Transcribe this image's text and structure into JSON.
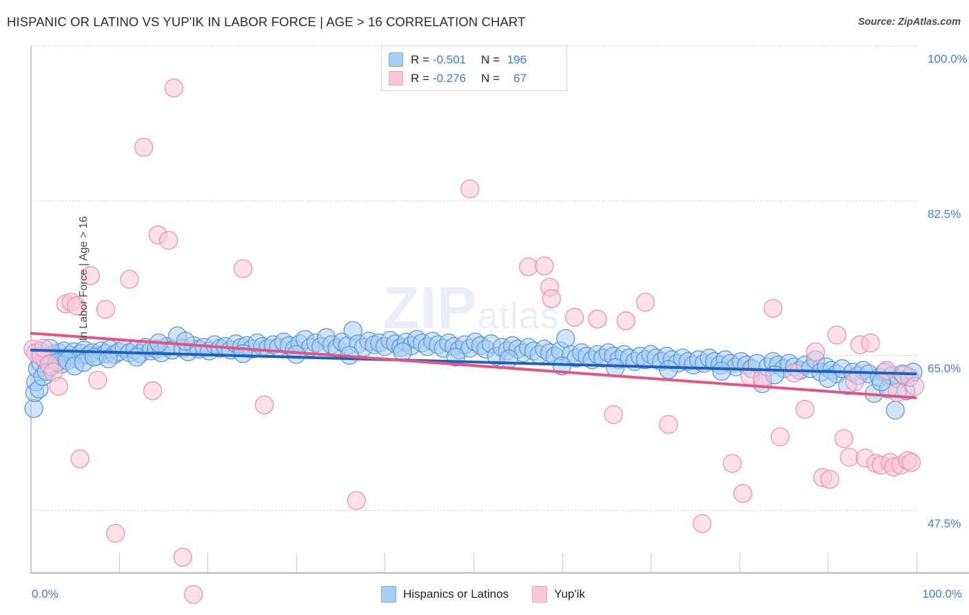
{
  "header": {
    "title": "HISPANIC OR LATINO VS YUP'IK IN LABOR FORCE | AGE > 16 CORRELATION CHART",
    "source": "Source: ZipAtlas.com"
  },
  "watermark": {
    "main": "ZIP",
    "small": "atlas"
  },
  "stats": {
    "rows": [
      {
        "series": "Hispanics or Latinos",
        "r_label": "R =",
        "r_value": "-0.501",
        "n_label": "N =",
        "n_value": "196",
        "color": "#aacdf2"
      },
      {
        "series": "Yup'ik",
        "r_label": "R =",
        "r_value": "-0.276",
        "n_label": "N =",
        "n_value": "67",
        "color": "#fbc6d6"
      }
    ]
  },
  "legend": {
    "items": [
      {
        "label": "Hispanics or Latinos",
        "color": "#aacdf2"
      },
      {
        "label": "Yup'ik",
        "color": "#fbc6d6"
      }
    ]
  },
  "axes": {
    "y_title": "In Labor Force | Age > 16",
    "y_ticks": [
      "100.0%",
      "82.5%",
      "65.0%",
      "47.5%"
    ],
    "x_min": "0.0%",
    "x_max": "100.0%"
  },
  "chart_data": {
    "type": "scatter",
    "title": "HISPANIC OR LATINO VS YUP'IK IN LABOR FORCE | AGE > 16 CORRELATION CHART",
    "xlabel": "",
    "ylabel": "In Labor Force | Age > 16",
    "xlim": [
      0,
      100
    ],
    "ylim": [
      40.5,
      100
    ],
    "x_ticks": [
      0,
      100
    ],
    "x_tick_labels": [
      "0.0%",
      "100.0%"
    ],
    "y_ticks": [
      47.5,
      65.0,
      82.5,
      100.0
    ],
    "y_tick_labels": [
      "47.5%",
      "65.0%",
      "82.5%",
      "100.0%"
    ],
    "grid": "horizontal-dashed",
    "legend_position": "bottom-center",
    "series": [
      {
        "name": "Hispanics or Latinos",
        "color": "#aacdf2",
        "edge_color": "#5b97d8",
        "r": -0.501,
        "n": 196,
        "trend": {
          "color": "#1c5fc4",
          "x0": 0,
          "y0": 65.6,
          "x1": 100,
          "y1": 62.9
        },
        "points": [
          [
            0.4,
            59.0
          ],
          [
            0.5,
            60.8
          ],
          [
            0.6,
            62.0
          ],
          [
            0.8,
            63.5
          ],
          [
            1.0,
            61.2
          ],
          [
            1.2,
            64.1
          ],
          [
            1.4,
            62.6
          ],
          [
            1.6,
            64.6
          ],
          [
            1.8,
            63.2
          ],
          [
            2.0,
            64.9
          ],
          [
            2.3,
            63.7
          ],
          [
            2.6,
            65.1
          ],
          [
            2.9,
            64.3
          ],
          [
            3.2,
            65.3
          ],
          [
            3.5,
            64.0
          ],
          [
            3.8,
            65.5
          ],
          [
            4.1,
            64.7
          ],
          [
            4.5,
            65.0
          ],
          [
            4.9,
            65.4
          ],
          [
            5.3,
            64.6
          ],
          [
            5.7,
            65.2
          ],
          [
            6.1,
            65.6
          ],
          [
            6.6,
            65.0
          ],
          [
            7.0,
            65.3
          ],
          [
            7.5,
            64.9
          ],
          [
            8.0,
            65.5
          ],
          [
            8.5,
            65.2
          ],
          [
            9.0,
            65.7
          ],
          [
            9.5,
            65.1
          ],
          [
            10.0,
            65.4
          ],
          [
            10.6,
            65.8
          ],
          [
            11.2,
            65.3
          ],
          [
            11.8,
            65.6
          ],
          [
            12.4,
            65.2
          ],
          [
            13.0,
            65.9
          ],
          [
            13.6,
            65.5
          ],
          [
            14.2,
            65.7
          ],
          [
            14.8,
            65.3
          ],
          [
            15.4,
            66.0
          ],
          [
            16.0,
            65.6
          ],
          [
            16.6,
            67.2
          ],
          [
            17.2,
            65.8
          ],
          [
            17.8,
            65.4
          ],
          [
            18.4,
            66.1
          ],
          [
            19.0,
            65.7
          ],
          [
            19.6,
            65.9
          ],
          [
            20.2,
            65.5
          ],
          [
            20.8,
            66.2
          ],
          [
            21.4,
            65.8
          ],
          [
            22.0,
            66.0
          ],
          [
            22.6,
            65.6
          ],
          [
            23.2,
            66.3
          ],
          [
            23.8,
            65.9
          ],
          [
            24.4,
            66.1
          ],
          [
            25.0,
            65.7
          ],
          [
            25.6,
            66.4
          ],
          [
            26.2,
            66.0
          ],
          [
            26.8,
            65.8
          ],
          [
            27.4,
            66.2
          ],
          [
            28.0,
            65.9
          ],
          [
            28.6,
            66.5
          ],
          [
            29.2,
            66.1
          ],
          [
            29.8,
            65.7
          ],
          [
            30.4,
            66.3
          ],
          [
            31.0,
            66.8
          ],
          [
            31.6,
            65.9
          ],
          [
            32.2,
            66.4
          ],
          [
            32.8,
            66.0
          ],
          [
            33.4,
            67.0
          ],
          [
            34.0,
            66.2
          ],
          [
            34.6,
            65.8
          ],
          [
            35.2,
            66.5
          ],
          [
            35.8,
            66.1
          ],
          [
            36.4,
            67.8
          ],
          [
            37.0,
            66.3
          ],
          [
            37.6,
            65.9
          ],
          [
            38.2,
            66.6
          ],
          [
            38.8,
            66.2
          ],
          [
            39.4,
            66.4
          ],
          [
            40.0,
            66.0
          ],
          [
            40.6,
            66.7
          ],
          [
            41.2,
            66.3
          ],
          [
            41.8,
            65.9
          ],
          [
            42.4,
            66.5
          ],
          [
            43.0,
            66.1
          ],
          [
            43.6,
            66.8
          ],
          [
            44.2,
            66.4
          ],
          [
            44.8,
            66.0
          ],
          [
            45.4,
            66.6
          ],
          [
            46.0,
            66.2
          ],
          [
            46.6,
            65.8
          ],
          [
            47.2,
            66.4
          ],
          [
            47.8,
            66.0
          ],
          [
            48.4,
            65.6
          ],
          [
            49.0,
            66.2
          ],
          [
            49.6,
            65.8
          ],
          [
            50.2,
            66.5
          ],
          [
            50.8,
            66.1
          ],
          [
            51.4,
            65.7
          ],
          [
            52.0,
            66.3
          ],
          [
            52.6,
            64.9
          ],
          [
            53.2,
            65.9
          ],
          [
            53.8,
            65.5
          ],
          [
            54.4,
            66.1
          ],
          [
            55.0,
            65.7
          ],
          [
            55.6,
            65.3
          ],
          [
            56.2,
            65.9
          ],
          [
            56.8,
            65.5
          ],
          [
            57.4,
            65.1
          ],
          [
            58.0,
            65.7
          ],
          [
            58.6,
            65.3
          ],
          [
            59.2,
            64.9
          ],
          [
            59.8,
            65.5
          ],
          [
            60.4,
            66.9
          ],
          [
            61.0,
            65.1
          ],
          [
            61.6,
            64.7
          ],
          [
            62.2,
            65.3
          ],
          [
            62.8,
            64.9
          ],
          [
            63.4,
            64.5
          ],
          [
            64.0,
            65.1
          ],
          [
            64.6,
            64.7
          ],
          [
            65.2,
            65.3
          ],
          [
            65.8,
            64.9
          ],
          [
            66.4,
            64.5
          ],
          [
            67.0,
            65.1
          ],
          [
            67.6,
            64.7
          ],
          [
            68.2,
            64.3
          ],
          [
            68.8,
            64.9
          ],
          [
            69.4,
            64.5
          ],
          [
            70.0,
            65.1
          ],
          [
            70.6,
            64.7
          ],
          [
            71.2,
            64.3
          ],
          [
            71.8,
            64.9
          ],
          [
            72.4,
            64.5
          ],
          [
            73.0,
            64.1
          ],
          [
            73.6,
            64.7
          ],
          [
            74.2,
            64.3
          ],
          [
            74.8,
            63.9
          ],
          [
            75.4,
            64.5
          ],
          [
            76.0,
            64.1
          ],
          [
            76.6,
            64.7
          ],
          [
            77.2,
            64.3
          ],
          [
            77.8,
            63.9
          ],
          [
            78.4,
            64.5
          ],
          [
            79.0,
            64.1
          ],
          [
            79.6,
            63.7
          ],
          [
            80.2,
            64.3
          ],
          [
            80.8,
            63.9
          ],
          [
            81.4,
            63.5
          ],
          [
            82.0,
            64.1
          ],
          [
            82.6,
            61.8
          ],
          [
            83.2,
            63.7
          ],
          [
            83.8,
            64.3
          ],
          [
            84.4,
            63.9
          ],
          [
            85.0,
            63.5
          ],
          [
            85.6,
            64.1
          ],
          [
            86.2,
            63.7
          ],
          [
            86.8,
            63.3
          ],
          [
            87.4,
            63.9
          ],
          [
            88.0,
            63.5
          ],
          [
            88.6,
            64.5
          ],
          [
            89.2,
            63.1
          ],
          [
            89.8,
            63.7
          ],
          [
            90.4,
            63.3
          ],
          [
            91.0,
            62.9
          ],
          [
            91.6,
            63.5
          ],
          [
            92.2,
            61.6
          ],
          [
            92.8,
            63.1
          ],
          [
            93.4,
            62.7
          ],
          [
            94.0,
            63.3
          ],
          [
            94.6,
            62.9
          ],
          [
            95.2,
            60.7
          ],
          [
            95.8,
            62.5
          ],
          [
            96.4,
            63.1
          ],
          [
            96.8,
            61.2
          ],
          [
            97.2,
            62.7
          ],
          [
            97.6,
            58.8
          ],
          [
            98.0,
            62.3
          ],
          [
            98.4,
            62.9
          ],
          [
            98.8,
            61.0
          ],
          [
            99.2,
            62.5
          ],
          [
            99.6,
            63.1
          ],
          [
            1.1,
            65.5
          ],
          [
            2.2,
            65.8
          ],
          [
            3.0,
            64.2
          ],
          [
            4.2,
            64.4
          ],
          [
            5.0,
            63.8
          ],
          [
            6.0,
            64.2
          ],
          [
            7.2,
            64.8
          ],
          [
            8.8,
            64.6
          ],
          [
            12.0,
            64.8
          ],
          [
            14.5,
            66.4
          ],
          [
            17.5,
            66.6
          ],
          [
            24.0,
            65.2
          ],
          [
            30.0,
            65.1
          ],
          [
            36.0,
            65.0
          ],
          [
            42.0,
            65.4
          ],
          [
            48.0,
            64.8
          ],
          [
            54.0,
            64.6
          ],
          [
            60.0,
            63.8
          ],
          [
            66.0,
            63.6
          ],
          [
            72.0,
            63.4
          ],
          [
            78.0,
            63.2
          ],
          [
            84.0,
            62.8
          ],
          [
            90.0,
            62.4
          ],
          [
            96.0,
            62.0
          ]
        ]
      },
      {
        "name": "Yup'ik",
        "color": "#fbc6d6",
        "edge_color": "#ef90b2",
        "r": -0.276,
        "n": 67,
        "trend": {
          "color": "#e8527f",
          "x0": 0,
          "y0": 67.5,
          "x1": 100,
          "y1": 60.2
        },
        "points": [
          [
            0.3,
            65.7
          ],
          [
            0.6,
            65.3
          ],
          [
            1.2,
            64.9
          ],
          [
            1.5,
            65.8
          ],
          [
            2.1,
            64.0
          ],
          [
            2.6,
            63.1
          ],
          [
            3.2,
            61.5
          ],
          [
            4.0,
            70.8
          ],
          [
            4.6,
            71.0
          ],
          [
            5.2,
            70.6
          ],
          [
            5.6,
            53.3
          ],
          [
            6.8,
            74.0
          ],
          [
            7.6,
            62.2
          ],
          [
            8.5,
            70.2
          ],
          [
            9.6,
            44.9
          ],
          [
            11.2,
            73.6
          ],
          [
            12.8,
            88.5
          ],
          [
            13.8,
            61.0
          ],
          [
            14.4,
            78.6
          ],
          [
            15.6,
            78.0
          ],
          [
            16.2,
            95.2
          ],
          [
            17.2,
            42.2
          ],
          [
            18.4,
            38.0
          ],
          [
            24.0,
            74.8
          ],
          [
            26.4,
            59.4
          ],
          [
            36.8,
            48.6
          ],
          [
            49.6,
            83.8
          ],
          [
            56.2,
            75.0
          ],
          [
            58.0,
            75.1
          ],
          [
            58.6,
            72.7
          ],
          [
            58.8,
            71.4
          ],
          [
            61.4,
            69.3
          ],
          [
            64.0,
            69.1
          ],
          [
            67.2,
            68.9
          ],
          [
            65.8,
            58.3
          ],
          [
            69.4,
            71.0
          ],
          [
            72.0,
            57.2
          ],
          [
            75.8,
            46.0
          ],
          [
            79.2,
            52.8
          ],
          [
            80.4,
            49.4
          ],
          [
            81.2,
            62.6
          ],
          [
            82.6,
            62.4
          ],
          [
            83.8,
            70.3
          ],
          [
            84.6,
            55.8
          ],
          [
            86.2,
            63.0
          ],
          [
            87.4,
            58.9
          ],
          [
            88.6,
            65.4
          ],
          [
            89.4,
            51.2
          ],
          [
            90.2,
            51.0
          ],
          [
            91.0,
            67.3
          ],
          [
            91.8,
            55.6
          ],
          [
            92.4,
            53.5
          ],
          [
            93.0,
            62.0
          ],
          [
            93.6,
            66.2
          ],
          [
            94.2,
            53.4
          ],
          [
            94.8,
            66.4
          ],
          [
            95.4,
            52.8
          ],
          [
            96.0,
            52.6
          ],
          [
            96.6,
            63.3
          ],
          [
            97.0,
            52.9
          ],
          [
            97.4,
            52.4
          ],
          [
            97.8,
            60.8
          ],
          [
            98.2,
            52.6
          ],
          [
            98.6,
            62.8
          ],
          [
            99.0,
            53.1
          ],
          [
            99.4,
            52.9
          ],
          [
            99.8,
            61.5
          ]
        ]
      }
    ]
  }
}
